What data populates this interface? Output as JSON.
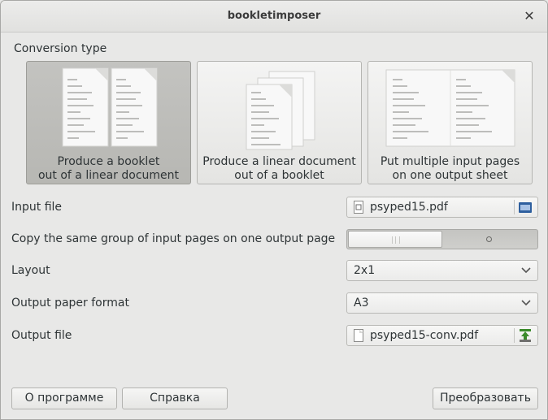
{
  "window": {
    "title": "bookletimposer"
  },
  "conversion": {
    "label": "Conversion type",
    "options": [
      {
        "line1": "Produce a booklet",
        "line2": "out of a linear document",
        "selected": true
      },
      {
        "line1": "Produce a linear document",
        "line2": "out of a booklet",
        "selected": false
      },
      {
        "line1": "Put multiple input pages",
        "line2": "on one output sheet",
        "selected": false
      }
    ]
  },
  "form": {
    "input_file": {
      "label": "Input file",
      "value": "psyped15.pdf"
    },
    "copy_group": {
      "label": "Copy the same group of input pages on one output page",
      "state": "off"
    },
    "layout": {
      "label": "Layout",
      "value": "2x1"
    },
    "paper": {
      "label": "Output paper format",
      "value": "A3"
    },
    "output_file": {
      "label": "Output file",
      "value": "psyped15-conv.pdf"
    }
  },
  "buttons": {
    "about": "О программе",
    "help": "Справка",
    "convert": "Преобразовать"
  },
  "colors": {
    "window_bg": "#e8e8e7",
    "active_tile": "#bdbdba",
    "folder_icon": "#2e5f9e",
    "save_icon": "#3a8a2a"
  }
}
